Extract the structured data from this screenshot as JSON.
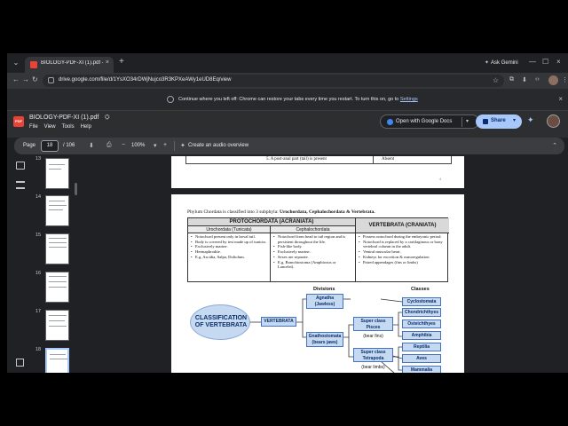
{
  "browser": {
    "tab": {
      "title": "BIOLOGY-PDF-XI (1).pdf - Goo...",
      "close": "×",
      "new_tab": "+"
    },
    "ask_gemini": "Ask Gemini",
    "window": {
      "min": "—",
      "max": "☐",
      "close": "×"
    },
    "nav": {
      "back": "←",
      "forward": "→",
      "reload": "↻"
    },
    "url": "drive.google.com/file/d/1YsXO34rDWjNujco3R3KPXeAWy1eUD8Eq/view",
    "infobar": {
      "text": "Continue where you left off: Chrome can restore your tabs every time you restart. To turn this on, go to",
      "link": "Settings",
      "close": "×"
    }
  },
  "drive": {
    "pdf_badge": "PDF",
    "file_title": "BIOLOGY-PDF-XI (1).pdf",
    "menus": [
      "File",
      "View",
      "Tools",
      "Help"
    ],
    "open_with": "Open with Google Docs",
    "share": "Share"
  },
  "pdf_toolbar": {
    "page_label": "Page",
    "page_value": "18",
    "page_total": "/  106",
    "zoom": "100%",
    "audio": "Create an audio overview"
  },
  "thumbnails": [
    {
      "num": "13"
    },
    {
      "num": "14"
    },
    {
      "num": "15"
    },
    {
      "num": "16"
    },
    {
      "num": "17"
    },
    {
      "num": "18"
    }
  ],
  "prev_page": {
    "cell1": "5. A post-anal part (tail) is present",
    "cell2": "Absent",
    "page_number": "4"
  },
  "page": {
    "intro_plain": "Phylum Chordata is classified into 3 subphyla: ",
    "intro_bold": "Urochordata, Cephalochordata & Vertebrata.",
    "table": {
      "protochordata": "PROTOCHORDATA (ACRANIATA)",
      "vertebrata": "VERTEBRATA (CRANIATA)",
      "urochordata": "Urochordata (Tunicata)",
      "cephalochordata": "Cephalochordata",
      "col1": [
        "Notochord present only in larval tail.",
        "Body is covered by test made up of tunicin.",
        "Exclusively marine.",
        "Hermaphrodite.",
        "E.g. Ascidia, Salpa, Doliolum."
      ],
      "col2": [
        "Notochord from head to tail region and is persistent throughout the life.",
        "Fish-like body.",
        "Exclusively marine.",
        "Sexes are separate.",
        "E.g. Branchiostoma (Amphioxus or Lancelet)."
      ],
      "col3": [
        "Possess notochord during the embryonic period.",
        "Notochord is replaced by a cartilaginous or bony vertebral column in the adult.",
        "Ventral muscular heart.",
        "Kidneys for excretion & osmoregulation",
        "Paired appendages (fins or limbs)"
      ]
    },
    "diagram": {
      "divisions_label": "Divisions",
      "classes_label": "Classes",
      "title_line1": "CLASSIFICATION",
      "title_line2": "OF VERTEBRATA",
      "vertebrata": "VERTEBRATA",
      "agnatha": "Agnatha",
      "agnatha_sub": "(Jawless)",
      "gnathostomata": "Gnathostomata",
      "gnathostomata_sub": "(bears jaws)",
      "pisces": "Super class",
      "pisces2": "Pisces",
      "pisces_sub": "(bear fins)",
      "tetrapoda": "Super class",
      "tetrapoda2": "Tetrapoda",
      "tetrapoda_sub": "(bear limbs)",
      "classes": [
        "Cyclostomata",
        "Chondrichthyes",
        "Osteichthyes",
        "Amphibia",
        "Reptilia",
        "Aves",
        "Mammalia"
      ]
    }
  }
}
